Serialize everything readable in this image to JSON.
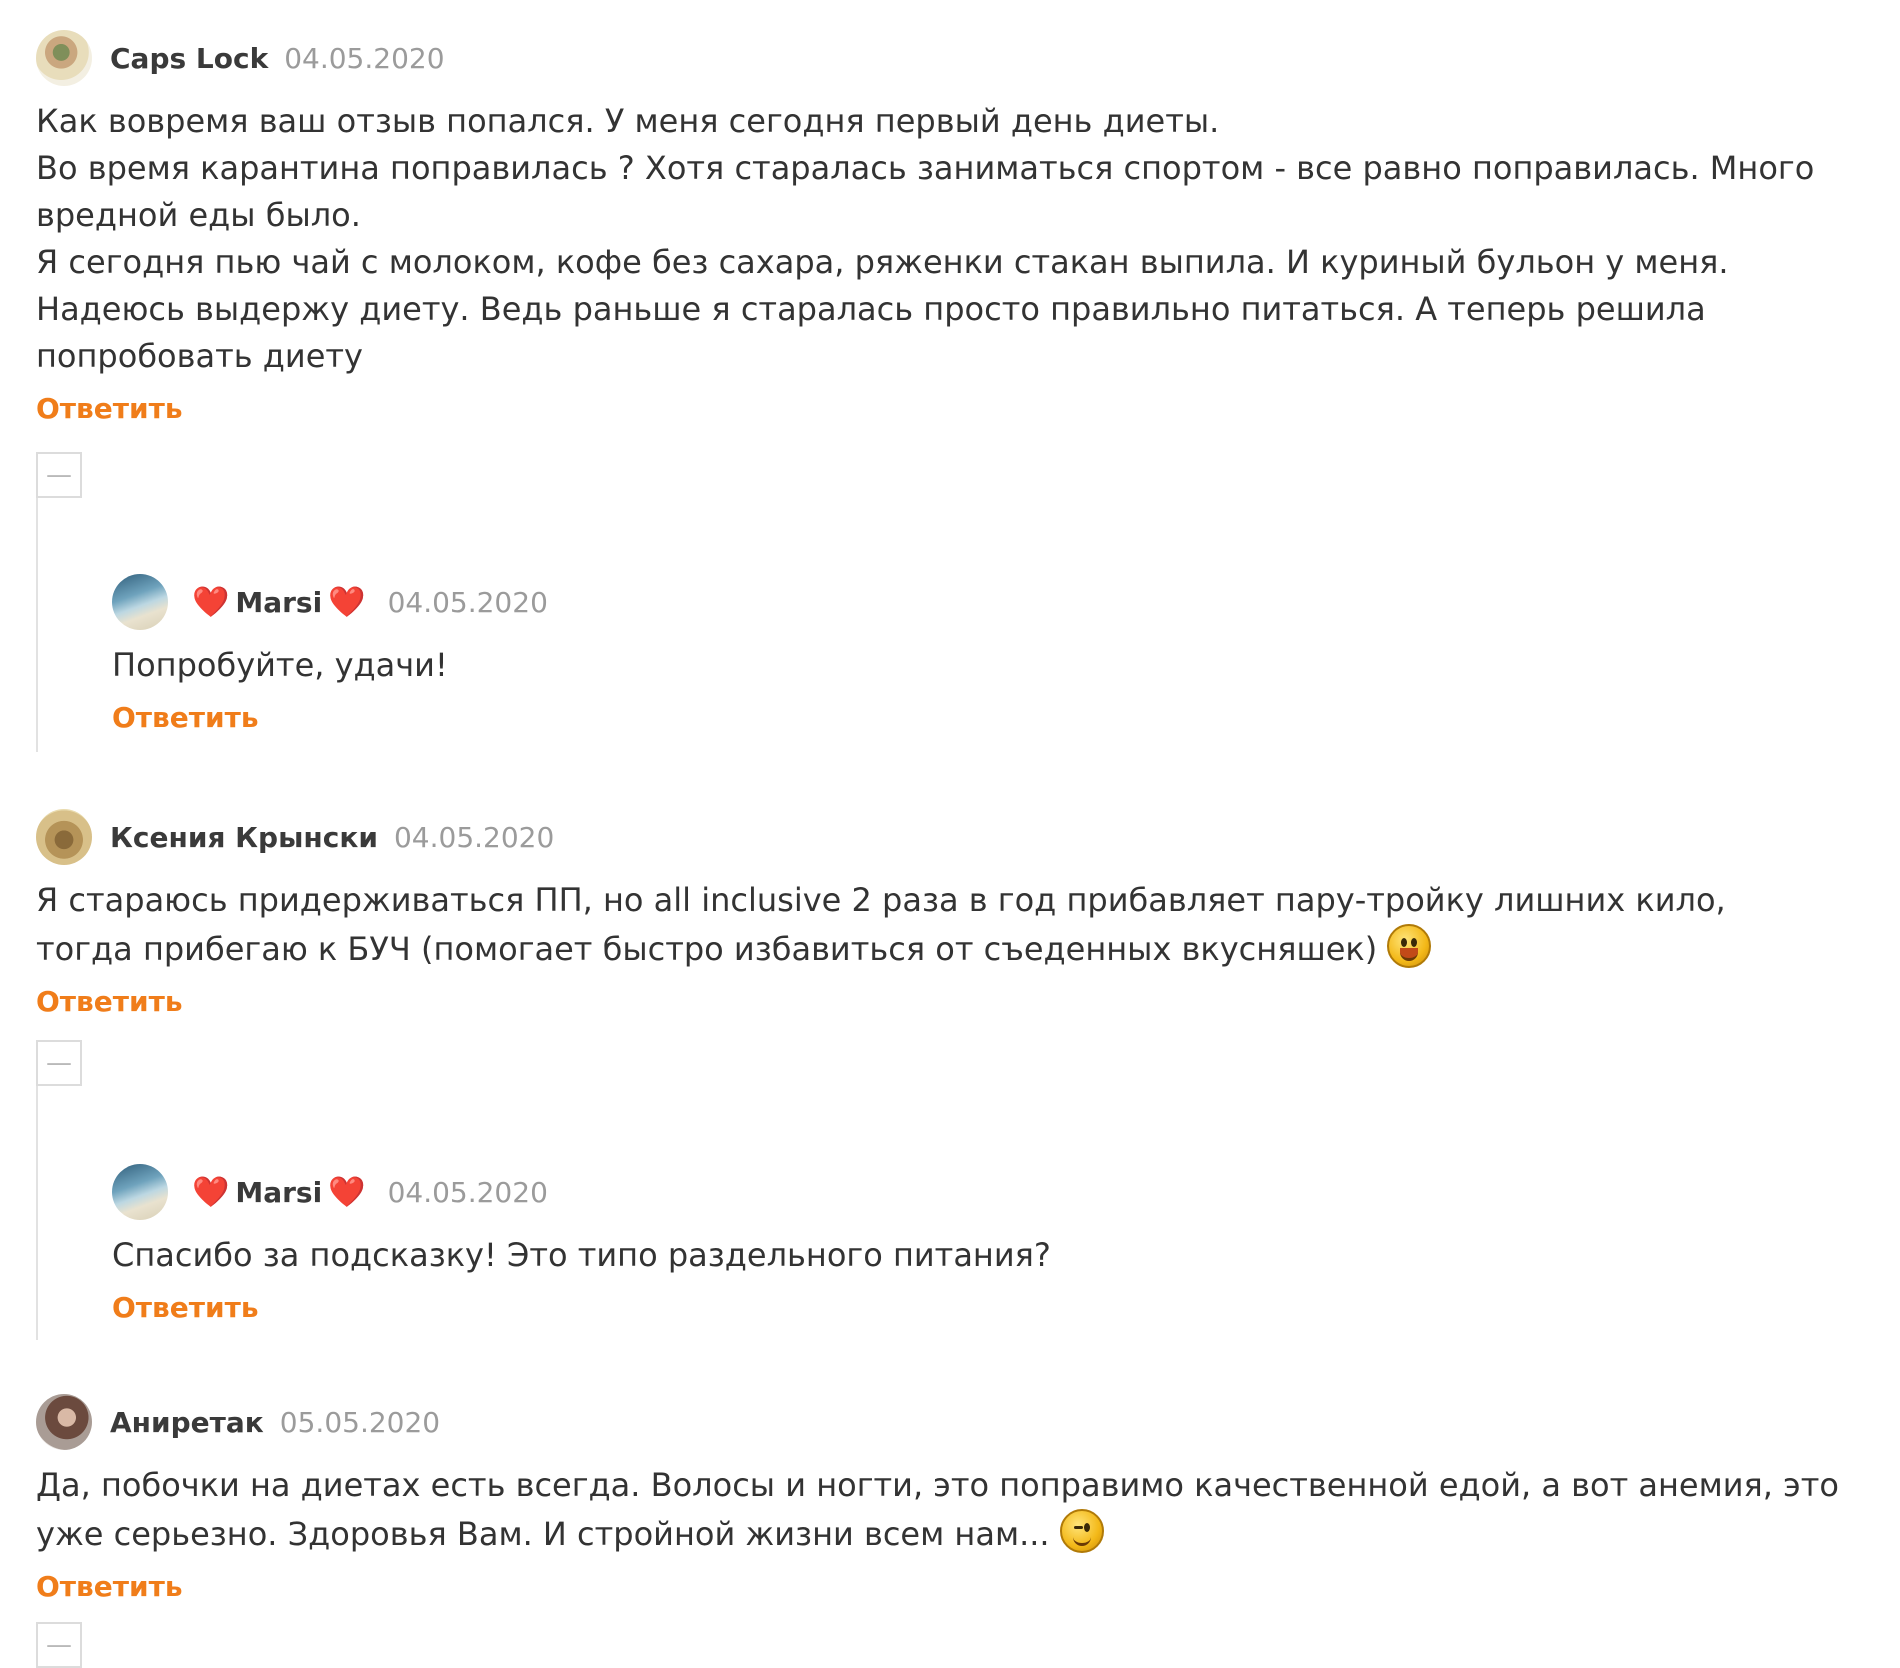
{
  "comments": [
    {
      "author": "Caps Lock",
      "date": "04.05.2020",
      "text": "Как вовремя ваш отзыв попался. У меня сегодня первый день диеты.\nВо время карантина поправилась ? Хотя старалась заниматься спортом - все равно поправилась. Много вредной еды было.\nЯ сегодня пью чай с молоком, кофе без сахара, ряженки стакан выпила. И куриный бульон у меня. Надеюсь выдержу диету. Ведь раньше я старалась просто правильно питаться. А теперь решила попробовать диету",
      "reply_label": "Ответить",
      "reply": {
        "author": "Marsi",
        "heart": "❤️",
        "date": "04.05.2020",
        "text": "Попробуйте, удачи!",
        "reply_label": "Ответить"
      }
    },
    {
      "author": "Ксения Крынски",
      "date": "04.05.2020",
      "text": "Я стараюсь придерживаться ПП, но all inclusive 2 раза в год прибавляет пару-тройку лишних кило, тогда прибегаю к БУЧ (помогает быстро избавиться от съеденных вкусняшек)",
      "emoji": "smile-emoji",
      "reply_label": "Ответить",
      "reply": {
        "author": "Marsi",
        "heart": "❤️",
        "date": "04.05.2020",
        "text": "Спасибо за подсказку! Это типо раздельного питания?",
        "reply_label": "Ответить"
      }
    },
    {
      "author": "Аниретак",
      "date": "05.05.2020",
      "text": "Да, побочки на диетах есть всегда. Волосы и ногти, это поправимо качественной едой, а вот анемия, это уже серьезно. Здоровья Вам. И стройной жизни всем нам...",
      "emoji": "wink-emoji",
      "reply_label": "Ответить"
    }
  ],
  "collapse_symbol": "—",
  "colors": {
    "reply_link": "#f07d1a",
    "date": "#9b9b9b",
    "heart": "#e0262b"
  }
}
